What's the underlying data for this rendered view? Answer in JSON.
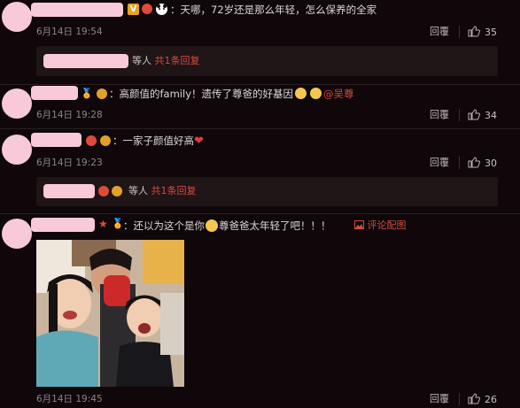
{
  "comments": [
    {
      "text": "：天哪，72岁还是那么年轻，怎么保养的全家",
      "time": "6月14日 19:54",
      "reply_label": "回覆",
      "likes": "35",
      "sub_reply": {
        "suffix": "等人",
        "count_text": "共1条回复"
      }
    },
    {
      "text_before": "：高颜值的family！遗传了尊爸的好基因",
      "mention": "@吴尊",
      "time": "6月14日 19:28",
      "reply_label": "回覆",
      "likes": "34"
    },
    {
      "text": "：一家子颜值好高",
      "time": "6月14日 19:23",
      "reply_label": "回覆",
      "likes": "30",
      "sub_reply": {
        "suffix": "等人",
        "count_text": "共1条回复"
      }
    },
    {
      "text_before": "：还以为这个是你",
      "text_after": "尊爸爸太年轻了吧！！！",
      "photo_link": "评论配图",
      "time": "6月14日 19:45",
      "reply_label": "回覆",
      "likes": "26"
    }
  ],
  "colors": {
    "background": "#0f0709",
    "redacted": "#f8c9d8",
    "accent_red": "#d74b3f",
    "reply_bar": "#1f1416"
  }
}
